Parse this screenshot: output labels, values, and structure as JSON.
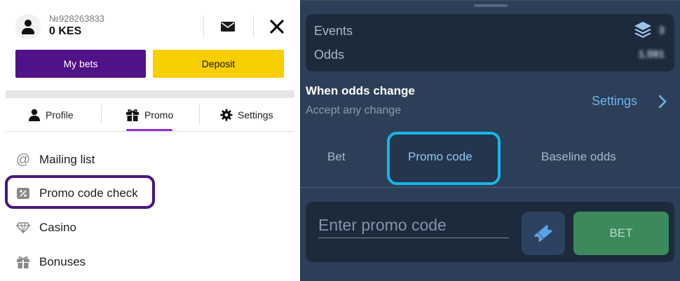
{
  "account": {
    "id": "№928263833",
    "balance": "0 KES"
  },
  "buttons": {
    "my_bets": "My bets",
    "deposit": "Deposit"
  },
  "profile_tabs": [
    {
      "label": "Profile",
      "icon": "person-icon"
    },
    {
      "label": "Promo",
      "icon": "gift-icon",
      "active": true
    },
    {
      "label": "Settings",
      "icon": "gear-icon"
    }
  ],
  "menu": [
    {
      "label": "Mailing list",
      "icon": "at-icon"
    },
    {
      "label": "Promo code check",
      "icon": "percent-tag-icon",
      "highlighted": true
    },
    {
      "label": "Casino",
      "icon": "diamond-icon"
    },
    {
      "label": "Bonuses",
      "icon": "gift-icon"
    }
  ],
  "bet_slip": {
    "events_label": "Events",
    "events_count": "3",
    "odds_label": "Odds",
    "odds_value": "1.591",
    "odds_change_title": "When odds change",
    "odds_change_value": "Accept any change",
    "settings_link": "Settings",
    "tabs": [
      "Bet",
      "Promo code",
      "Baseline odds"
    ],
    "active_tab": "Promo code",
    "promo_placeholder": "Enter promo code",
    "bet_button": "BET"
  },
  "colors": {
    "brand_purple": "#4f1287",
    "deposit_yellow": "#f7ce00",
    "highlight_cyan": "#15b7e8",
    "bet_green": "#3c8a5c",
    "slip_background": "#2d3f58"
  }
}
